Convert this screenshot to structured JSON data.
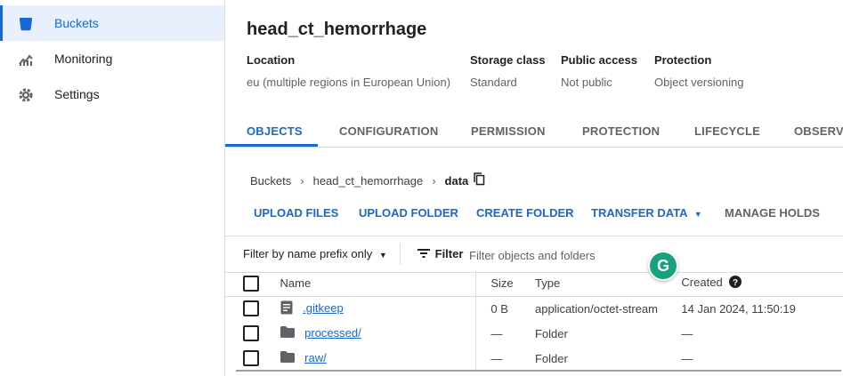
{
  "sidebar": {
    "items": [
      {
        "label": "Buckets",
        "icon": "bucket-icon",
        "active": true
      },
      {
        "label": "Monitoring",
        "icon": "chart-icon",
        "active": false
      },
      {
        "label": "Settings",
        "icon": "gear-icon",
        "active": false
      }
    ]
  },
  "bucket": {
    "title": "head_ct_hemorrhage",
    "meta": [
      {
        "key": "Location",
        "value": "eu (multiple regions in European Union)"
      },
      {
        "key": "Storage class",
        "value": "Standard"
      },
      {
        "key": "Public access",
        "value": "Not public"
      },
      {
        "key": "Protection",
        "value": "Object versioning"
      }
    ]
  },
  "tabs": [
    "OBJECTS",
    "CONFIGURATION",
    "PERMISSION",
    "PROTECTION",
    "LIFECYCLE",
    "OBSERVABILITY"
  ],
  "breadcrumb": [
    "Buckets",
    "head_ct_hemorrhage",
    "data"
  ],
  "actions": {
    "upload_files": "UPLOAD FILES",
    "upload_folder": "UPLOAD FOLDER",
    "create_folder": "CREATE FOLDER",
    "transfer_data": "TRANSFER DATA",
    "manage_holds": "MANAGE HOLDS"
  },
  "filter": {
    "prefix_label": "Filter by name prefix only",
    "filter_label": "Filter",
    "placeholder": "Filter objects and folders"
  },
  "table": {
    "headers": {
      "name": "Name",
      "size": "Size",
      "type": "Type",
      "created": "Created"
    },
    "rows": [
      {
        "name": ".gitkeep",
        "icon": "file-icon",
        "size": "0 B",
        "type": "application/octet-stream",
        "created": "14 Jan 2024, 11:50:19"
      },
      {
        "name": "processed/",
        "icon": "folder-icon",
        "size": "—",
        "type": "Folder",
        "created": "—"
      },
      {
        "name": "raw/",
        "icon": "folder-icon",
        "size": "—",
        "type": "Folder",
        "created": "—"
      }
    ]
  },
  "badge": {
    "letter": "G"
  },
  "colors": {
    "accent": "#1967d2",
    "badge": "#15a27c"
  }
}
